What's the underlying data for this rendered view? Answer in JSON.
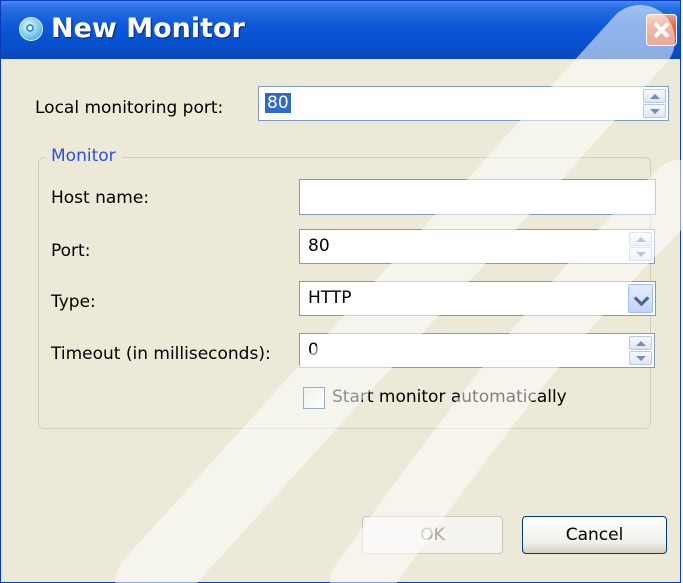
{
  "window": {
    "title": "New Monitor"
  },
  "local_port": {
    "label": "Local monitoring port:",
    "value": "80"
  },
  "monitor_group": {
    "legend": "Monitor",
    "host_name": {
      "label": "Host name:",
      "value": ""
    },
    "port": {
      "label": "Port:",
      "value": "80"
    },
    "type": {
      "label": "Type:",
      "value": "HTTP"
    },
    "timeout": {
      "label": "Timeout (in milliseconds):",
      "value": "0"
    },
    "start_auto": {
      "label": "Start monitor automatically",
      "checked": false
    }
  },
  "buttons": {
    "ok": "OK",
    "cancel": "Cancel"
  },
  "icons": [
    "app-icon",
    "close-icon",
    "spin-up-icon",
    "spin-down-icon",
    "chevron-down-icon"
  ],
  "colors": {
    "titlebar": "#0852d0",
    "dialog_bg": "#ece9d8",
    "legend_text": "#2f4fd8",
    "selection": "#316ac5"
  }
}
